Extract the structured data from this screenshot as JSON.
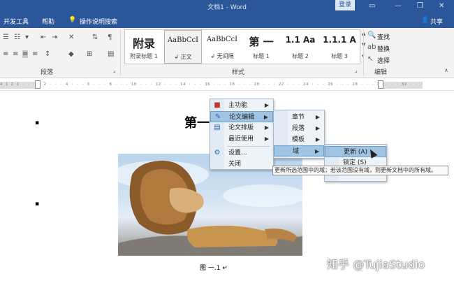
{
  "window": {
    "title": "文档1 - Word",
    "login_label": "登录",
    "minimize": "—",
    "restore": "❐",
    "close": "✕"
  },
  "menubar": {
    "items": [
      "开发工具",
      "帮助"
    ],
    "tell_me": "操作说明搜索",
    "share": "共享"
  },
  "ribbon": {
    "paragraph_label": "段落",
    "styles_label": "样式",
    "editing_label": "编辑",
    "styles": [
      {
        "preview": "附录",
        "name": "附录标题 1"
      },
      {
        "preview": "AaBbCcI",
        "name": "↲ 正文"
      },
      {
        "preview": "AaBbCcI",
        "name": "↲ 无间隔"
      },
      {
        "preview": "第 一",
        "name": "标题 1"
      },
      {
        "preview": "1.1  Aa",
        "name": "标题 2"
      },
      {
        "preview": "1.1.1  A",
        "name": "标题 3"
      }
    ],
    "find": "查找",
    "replace": "替换",
    "select": "选择"
  },
  "ruler": {
    "scale_text": "4 1 2 1 · · · · 2 · · · 4 · · · 6 · · · 8 · · · 10 · · · 12 · · · 14 · · · 16 · · · 18 · · · 20 · · · 22 · · · 24 · · · 26 · · · 28 · · · 30 · · · 32 · · · 34 · · · 36 · · · 38 · · · 40 · · · 42 · · · 44 · · · 46"
  },
  "document": {
    "heading_prefix": "第一",
    "caption": "图 一.1 ↵",
    "bullet": "▪",
    "watermark": "知乎 @TujiaStudio"
  },
  "menu_main": {
    "items": [
      {
        "label": "主功能",
        "icon": "main-function-icon",
        "has_sub": true
      },
      {
        "label": "论文编辑",
        "icon": "paper-edit-icon",
        "has_sub": true
      },
      {
        "label": "论文排版",
        "icon": "paper-layout-icon",
        "has_sub": true
      },
      {
        "label": "最近使用",
        "icon": "",
        "has_sub": true
      },
      {
        "label": "设置...",
        "icon": "settings-gear-icon",
        "has_sub": false
      },
      {
        "label": "关闭",
        "icon": "",
        "has_sub": false
      }
    ]
  },
  "menu_edit": {
    "items": [
      {
        "label": "章节",
        "has_sub": true
      },
      {
        "label": "段落",
        "has_sub": true
      },
      {
        "label": "模板",
        "has_sub": true
      },
      {
        "label": "域",
        "has_sub": true
      }
    ]
  },
  "menu_field": {
    "items": [
      {
        "label": "更新 (A)"
      },
      {
        "label": "锁定 (S)"
      }
    ]
  },
  "tooltip": {
    "text": "更新所选范围中的域；若该范围没有域，则更新文档中的所有域。"
  },
  "colors": {
    "word_blue": "#2b579a",
    "menu_bg": "#eef3f8",
    "highlight": "#9fc4e4"
  }
}
